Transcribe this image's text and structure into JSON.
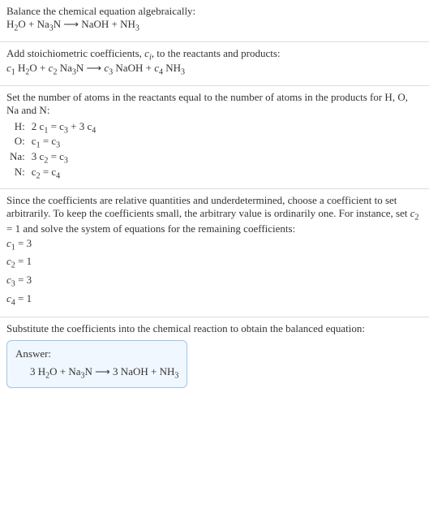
{
  "s1": {
    "line1": "Balance the chemical equation algebraically:",
    "eq_h2o": "H",
    "eq_h2o2": "2",
    "eq_h2o3": "O + Na",
    "eq_na3": "3",
    "eq_n": "N ⟶ NaOH + NH",
    "eq_nh3": "3"
  },
  "s2": {
    "line1a": "Add stoichiometric coefficients, ",
    "ci_c": "c",
    "ci_i": "i",
    "line1b": ", to the reactants and products:",
    "c1c": "c",
    "c1n": "1",
    "sp1": " H",
    "h2": "2",
    "o_plus": "O + ",
    "c2c": "c",
    "c2n": "2",
    "sp2": " Na",
    "na3": "3",
    "n_arrow": "N ⟶ ",
    "c3c": "c",
    "c3n": "3",
    "sp3": " NaOH + ",
    "c4c": "c",
    "c4n": "4",
    "sp4": " NH",
    "nh3": "3"
  },
  "s3": {
    "line1": "Set the number of atoms in the reactants equal to the number of atoms in the products for H, O, Na and N:",
    "rows": [
      {
        "lbl": "H:",
        "c_l": "2 c",
        "sub_l": "1",
        "eq": " = c",
        "sub_r1": "3",
        "plus": " + 3 c",
        "sub_r2": "4"
      },
      {
        "lbl": "O:",
        "c_l": "c",
        "sub_l": "1",
        "eq": " = c",
        "sub_r1": "3",
        "plus": "",
        "sub_r2": ""
      },
      {
        "lbl": "Na:",
        "c_l": "3 c",
        "sub_l": "2",
        "eq": " = c",
        "sub_r1": "3",
        "plus": "",
        "sub_r2": ""
      },
      {
        "lbl": "N:",
        "c_l": "c",
        "sub_l": "2",
        "eq": " = c",
        "sub_r1": "4",
        "plus": "",
        "sub_r2": ""
      }
    ]
  },
  "s4": {
    "line1a": "Since the coefficients are relative quantities and underdetermined, choose a coefficient to set arbitrarily. To keep the coefficients small, the arbitrary value is ordinarily one. For instance, set ",
    "c2c": "c",
    "c2n": "2",
    "line1b": " = 1 and solve the system of equations for the remaining coefficients:",
    "r1a": "c",
    "r1s": "1",
    "r1v": " = 3",
    "r2a": "c",
    "r2s": "2",
    "r2v": " = 1",
    "r3a": "c",
    "r3s": "3",
    "r3v": " = 3",
    "r4a": "c",
    "r4s": "4",
    "r4v": " = 1"
  },
  "s5": {
    "line1": "Substitute the coefficients into the chemical reaction to obtain the balanced equation:",
    "answer_label": "Answer:",
    "eq_pre": "3 H",
    "h2": "2",
    "mid": "O + Na",
    "na3": "3",
    "arr": "N ⟶ 3 NaOH + NH",
    "nh3": "3"
  }
}
